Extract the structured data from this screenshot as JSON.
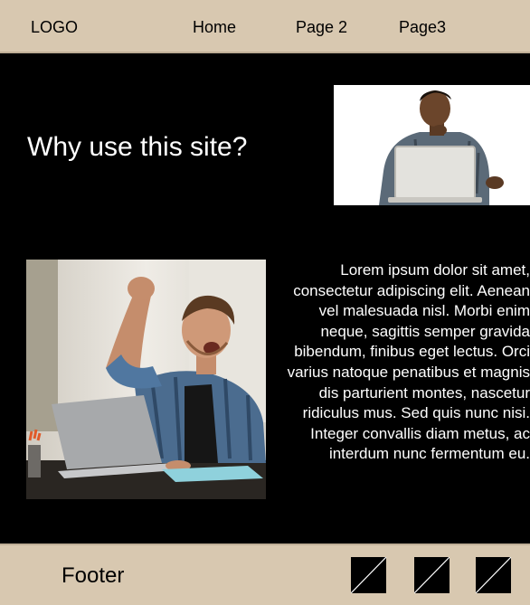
{
  "header": {
    "logo": "LOGO",
    "nav": [
      "Home",
      "Page 2",
      "Page3"
    ]
  },
  "hero": {
    "title": "Why use this site?"
  },
  "content": {
    "text": "Lorem ipsum dolor sit amet, consectetur adipiscing elit. Aenean vel malesuada nisl. Morbi enim neque, sagittis semper gravida bibendum, finibus eget lectus. Orci varius natoque penatibus et magnis dis parturient montes, nascetur ridiculus mus. Sed quis nunc nisi. Integer convallis diam metus, ac interdum nunc fermentum eu."
  },
  "footer": {
    "label": "Footer",
    "icons": [
      "placeholder-icon",
      "placeholder-icon",
      "placeholder-icon"
    ]
  },
  "colors": {
    "header_bg": "#d8c8b0",
    "page_bg": "#000000",
    "text_light": "#ffffff"
  }
}
